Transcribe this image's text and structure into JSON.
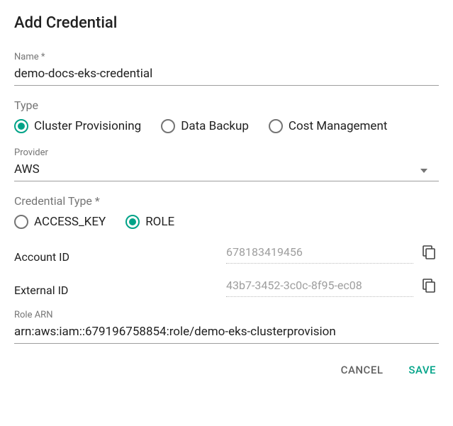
{
  "title": "Add Credential",
  "name_field": {
    "label": "Name *",
    "value": "demo-docs-eks-credential"
  },
  "type_field": {
    "label": "Type",
    "options": [
      {
        "label": "Cluster Provisioning",
        "selected": true
      },
      {
        "label": "Data Backup",
        "selected": false
      },
      {
        "label": "Cost Management",
        "selected": false
      }
    ]
  },
  "provider_field": {
    "label": "Provider",
    "value": "AWS"
  },
  "credential_type_field": {
    "label": "Credential Type *",
    "options": [
      {
        "label": "ACCESS_KEY",
        "selected": false
      },
      {
        "label": "ROLE",
        "selected": true
      }
    ]
  },
  "account_id": {
    "label": "Account ID",
    "value": "678183419456"
  },
  "external_id": {
    "label": "External ID",
    "value": "43b7-3452-3c0c-8f95-ec08"
  },
  "role_arn": {
    "label": "Role ARN",
    "value": "arn:aws:iam::679196758854:role/demo-eks-clusterprovision"
  },
  "actions": {
    "cancel": "CANCEL",
    "save": "SAVE"
  },
  "icons": {
    "copy": "copy-icon",
    "caret": "caret-down-icon"
  },
  "colors": {
    "accent": "#00a388"
  }
}
